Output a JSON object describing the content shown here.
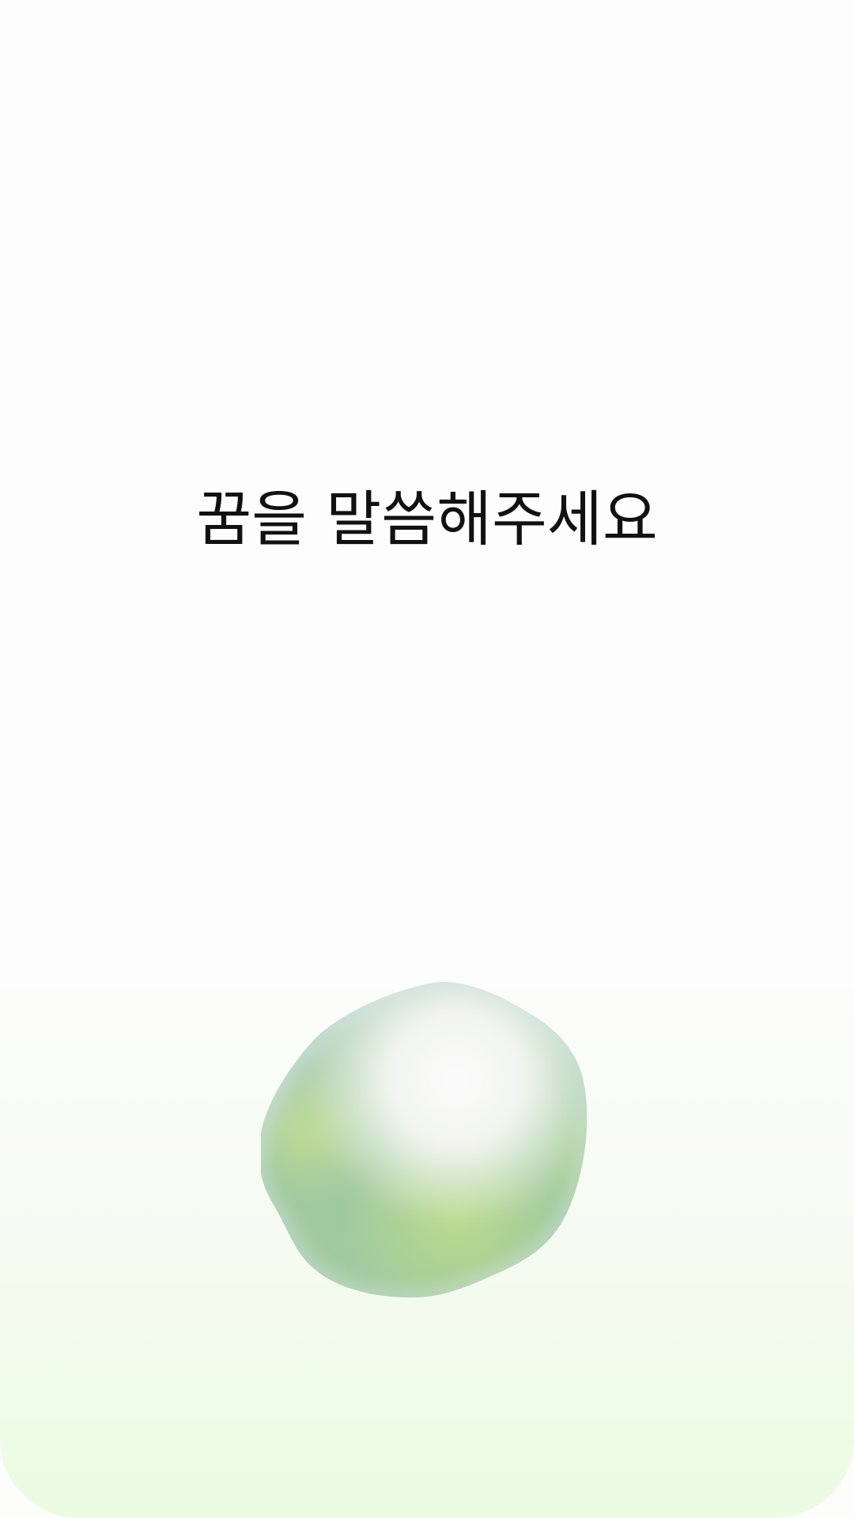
{
  "screen": {
    "prompt_text": "꿈을 말씀해주세요"
  },
  "orb": {
    "icon": "voice-orb-icon",
    "colors": {
      "green": "#9fcb9c",
      "lime": "#b6d98e",
      "highlight": "#fbfafc",
      "edge": "#dbe6f2"
    }
  },
  "background": {
    "top": "#fdfdfd",
    "bottom": "#ebfce2"
  }
}
